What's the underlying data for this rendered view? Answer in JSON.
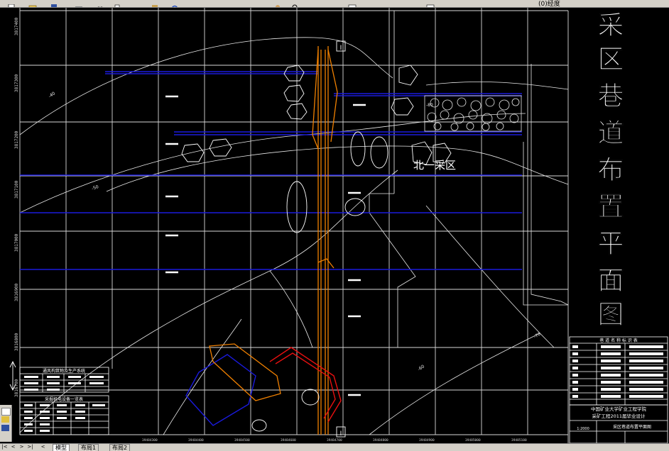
{
  "app": {
    "toolbar_partial_label": "(0)经度"
  },
  "drawing": {
    "vertical_title_chars": [
      "采",
      "区",
      "巷",
      "道",
      "布",
      "置",
      "平",
      "面",
      "图"
    ],
    "area_label": "北一采区",
    "contour_labels": [
      "-40",
      "-50",
      "-60",
      "-70",
      "-80"
    ],
    "section_markers": [
      "I",
      "I"
    ],
    "left_grid_labels": [
      "3817400",
      "3817300",
      "3817200",
      "3817100",
      "3817000",
      "3816900",
      "3816800",
      "3816700"
    ],
    "bottom_grid_labels": [
      "39484300",
      "39484400",
      "39484500",
      "39484600",
      "39484700",
      "39484800",
      "39484900",
      "39485000",
      "39485100"
    ],
    "table_top_title": "通风构筑物及生产系统",
    "table_bottom_title": "采掘机电设备一览表",
    "legend_title": "巷 道 名 称 标 识 表",
    "title_block": {
      "school": "中国矿业大学矿业工程学院",
      "project": "采矿工程2011届毕业设计",
      "scale": "1:2000",
      "drawing_name": "采区巷道布置平面图"
    }
  },
  "tabs": {
    "model": "模型",
    "layout1": "布局1",
    "layout2": "布局2"
  },
  "colors": {
    "background": "#000000",
    "grid": "#ffffff",
    "roadway_blue": "#0000d0",
    "roadway_orange": "#e07000",
    "roadway_red": "#e00000",
    "ui_gray": "#d4d0c8",
    "tab_active": "#ffffff"
  },
  "icons": [
    "new-file-icon",
    "open-icon",
    "save-icon",
    "print-icon",
    "cut-icon",
    "copy-icon",
    "paste-icon",
    "undo-icon",
    "pan-icon",
    "zoom-icon",
    "properties-icon",
    "layer-icon"
  ]
}
